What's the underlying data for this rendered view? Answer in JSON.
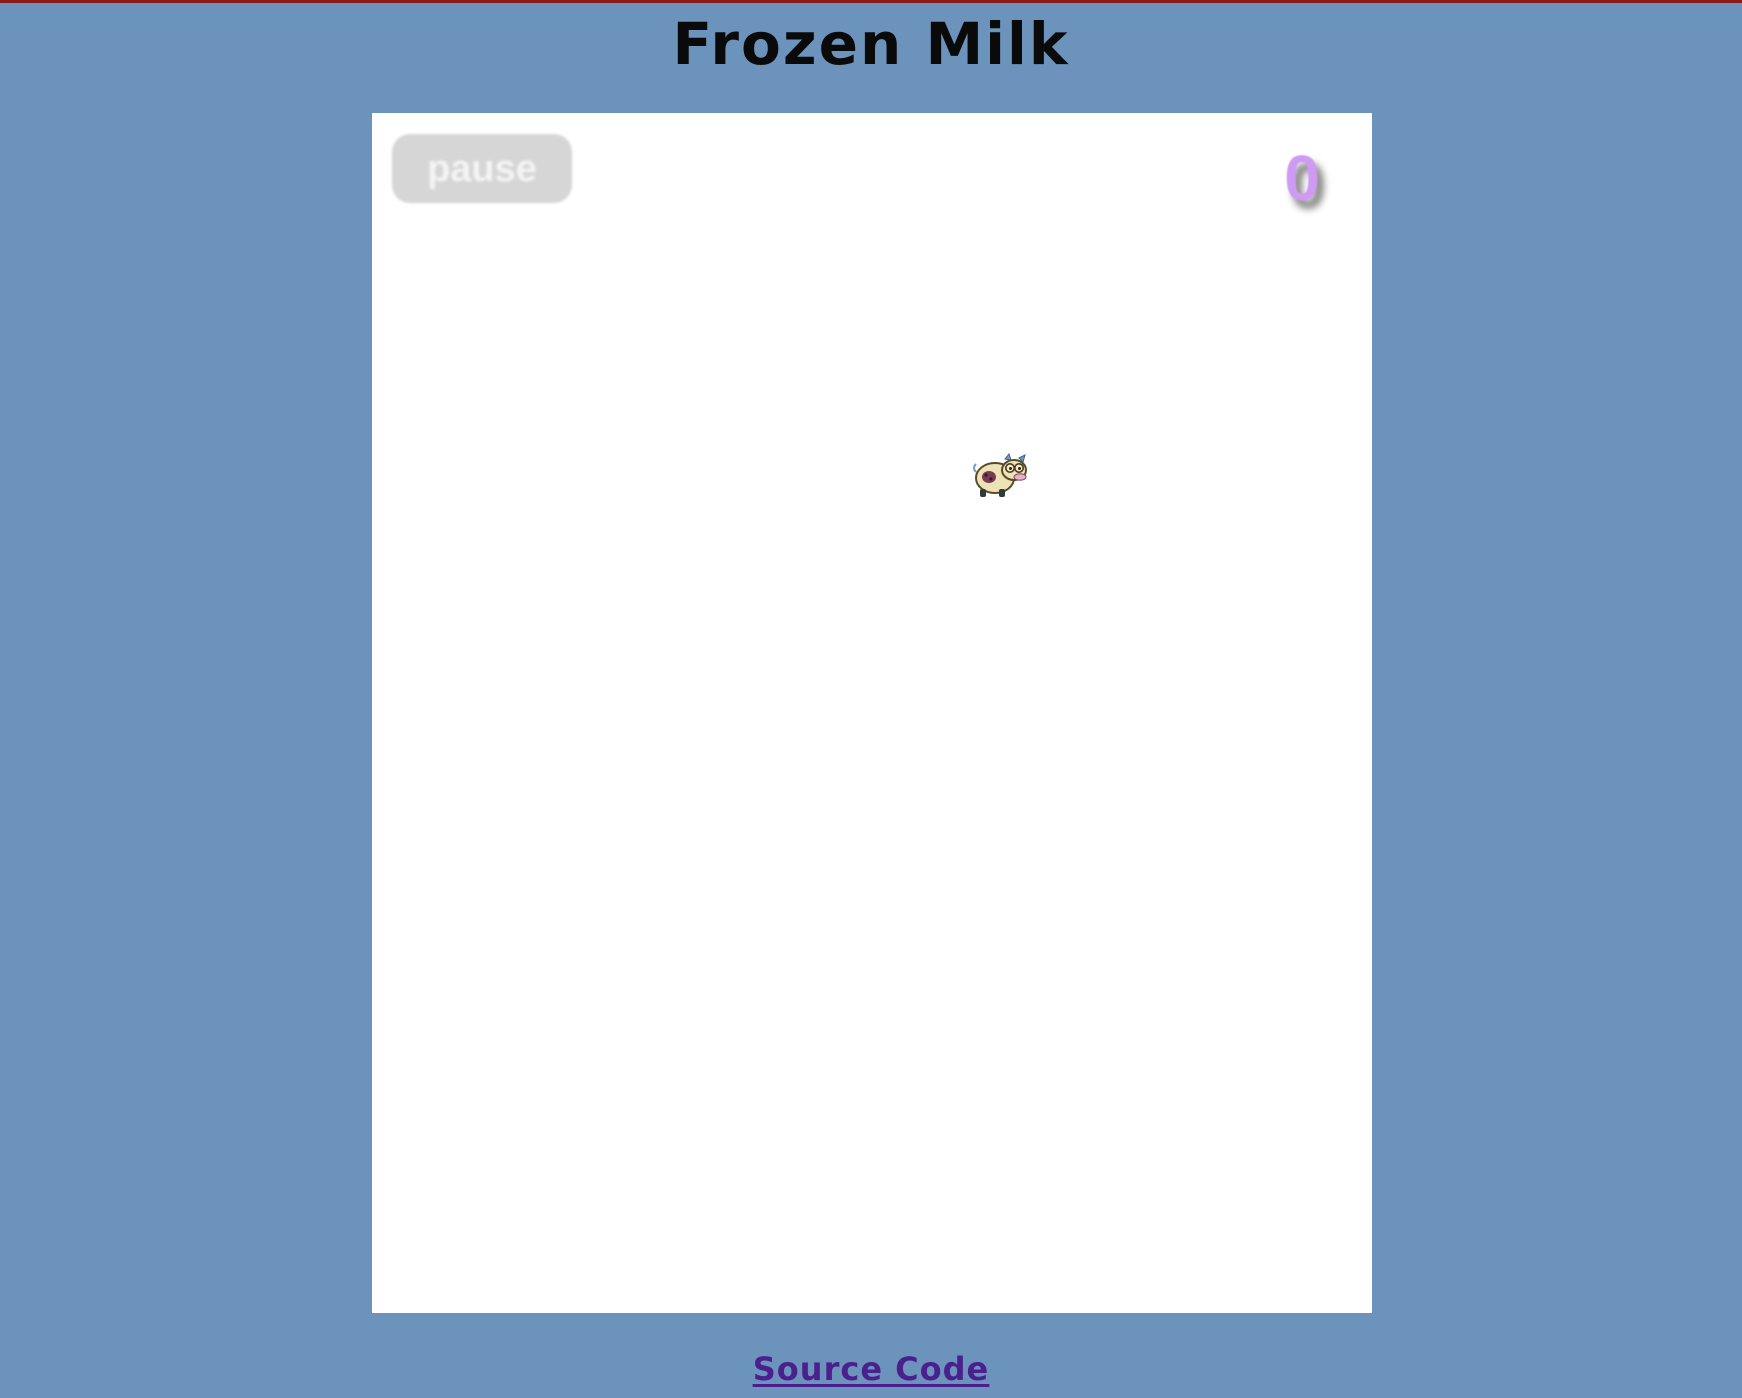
{
  "page": {
    "title": "Frozen Milk"
  },
  "game": {
    "pause_label": "pause",
    "score": "0",
    "player_sprite": "cow-icon"
  },
  "footer": {
    "source_link_label": "Source Code"
  },
  "colors": {
    "background": "#6b93bb",
    "canvas": "#ffffff",
    "pause_button": "#d6d6d6",
    "score": "#cf9af3",
    "link": "#4b1f8e",
    "top_rule": "#8b1a1a"
  }
}
